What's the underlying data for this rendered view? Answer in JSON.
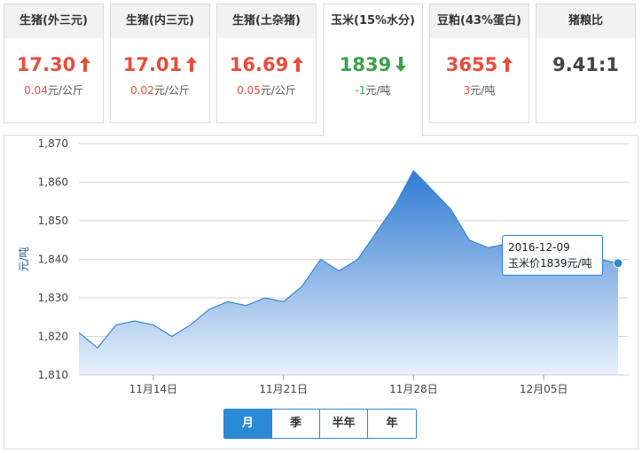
{
  "cards": [
    {
      "title": "生猪(外三元)",
      "value": "17.30",
      "direction": "up",
      "change_num": "0.04",
      "change_unit": "元/公斤"
    },
    {
      "title": "生猪(内三元)",
      "value": "17.01",
      "direction": "up",
      "change_num": "0.02",
      "change_unit": "元/公斤"
    },
    {
      "title": "生猪(土杂猪)",
      "value": "16.69",
      "direction": "up",
      "change_num": "0.05",
      "change_unit": "元/公斤"
    },
    {
      "title": "玉米(15%水分)",
      "value": "1839",
      "direction": "down",
      "change_num": "-1",
      "change_unit": "元/吨"
    },
    {
      "title": "豆粕(43%蛋白)",
      "value": "3655",
      "direction": "up",
      "change_num": "3",
      "change_unit": "元/吨"
    },
    {
      "title": "猪粮比",
      "value": "9.41:1",
      "direction": "none",
      "change_num": "",
      "change_unit": ""
    }
  ],
  "active_card": 3,
  "colors": {
    "up": "#e84c3d",
    "down": "#3aa14a",
    "line": "#3b86d6",
    "accent": "#2a8ad6"
  },
  "tabs": [
    "月",
    "季",
    "半年",
    "年"
  ],
  "active_tab": 0,
  "tooltip": {
    "date": "2016-12-09",
    "text": "玉米价1839元/吨"
  },
  "chart_data": {
    "type": "area",
    "x": [
      "2016-11-10",
      "2016-11-11",
      "2016-11-12",
      "2016-11-13",
      "2016-11-14",
      "2016-11-15",
      "2016-11-16",
      "2016-11-17",
      "2016-11-18",
      "2016-11-19",
      "2016-11-20",
      "2016-11-21",
      "2016-11-22",
      "2016-11-23",
      "2016-11-24",
      "2016-11-25",
      "2016-11-26",
      "2016-11-27",
      "2016-11-28",
      "2016-11-29",
      "2016-11-30",
      "2016-12-01",
      "2016-12-02",
      "2016-12-03",
      "2016-12-04",
      "2016-12-05",
      "2016-12-06",
      "2016-12-07",
      "2016-12-08",
      "2016-12-09"
    ],
    "values": [
      1821,
      1817,
      1823,
      1824,
      1823,
      1820,
      1823,
      1827,
      1829,
      1828,
      1830,
      1829,
      1833,
      1840,
      1837,
      1840,
      1847,
      1854,
      1863,
      1858,
      1853,
      1845,
      1843,
      1844,
      1844,
      1843,
      1843,
      1843,
      1840,
      1839
    ],
    "xticks": [
      {
        "date": "2016-11-14",
        "label": "11月14日"
      },
      {
        "date": "2016-11-21",
        "label": "11月21日"
      },
      {
        "date": "2016-11-28",
        "label": "11月28日"
      },
      {
        "date": "2016-12-05",
        "label": "12月05日"
      }
    ],
    "yticks": [
      1810,
      1820,
      1830,
      1840,
      1850,
      1860,
      1870
    ],
    "ytick_labels": [
      "1,810",
      "1,820",
      "1,830",
      "1,840",
      "1,850",
      "1,860",
      "1,870"
    ],
    "ylim": [
      1810,
      1870
    ],
    "ylabel": "元/吨",
    "xlabel": "",
    "grid": true,
    "legend": "none"
  }
}
